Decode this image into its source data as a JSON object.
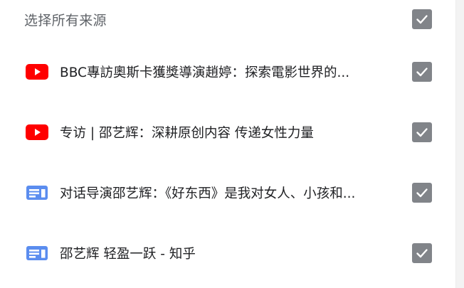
{
  "select_all": {
    "label": "选择所有来源",
    "checked": true
  },
  "sources": [
    {
      "icon": "youtube-icon",
      "title": "BBC專訪奧斯卡獲獎導演趙婷：探索電影世界的...",
      "checked": true
    },
    {
      "icon": "youtube-icon",
      "title": "专访 | 邵艺辉：深耕原创内容 传递女性力量",
      "checked": true
    },
    {
      "icon": "article-icon",
      "title": "对话导演邵艺辉：《好东西》是我对女人、小孩和...",
      "checked": true
    },
    {
      "icon": "article-icon",
      "title": "邵艺辉 轻盈一跃 - 知乎",
      "checked": true
    }
  ],
  "colors": {
    "youtube_red": "#ff0000",
    "article_blue": "#5b8def",
    "checkbox_gray": "#818489"
  }
}
